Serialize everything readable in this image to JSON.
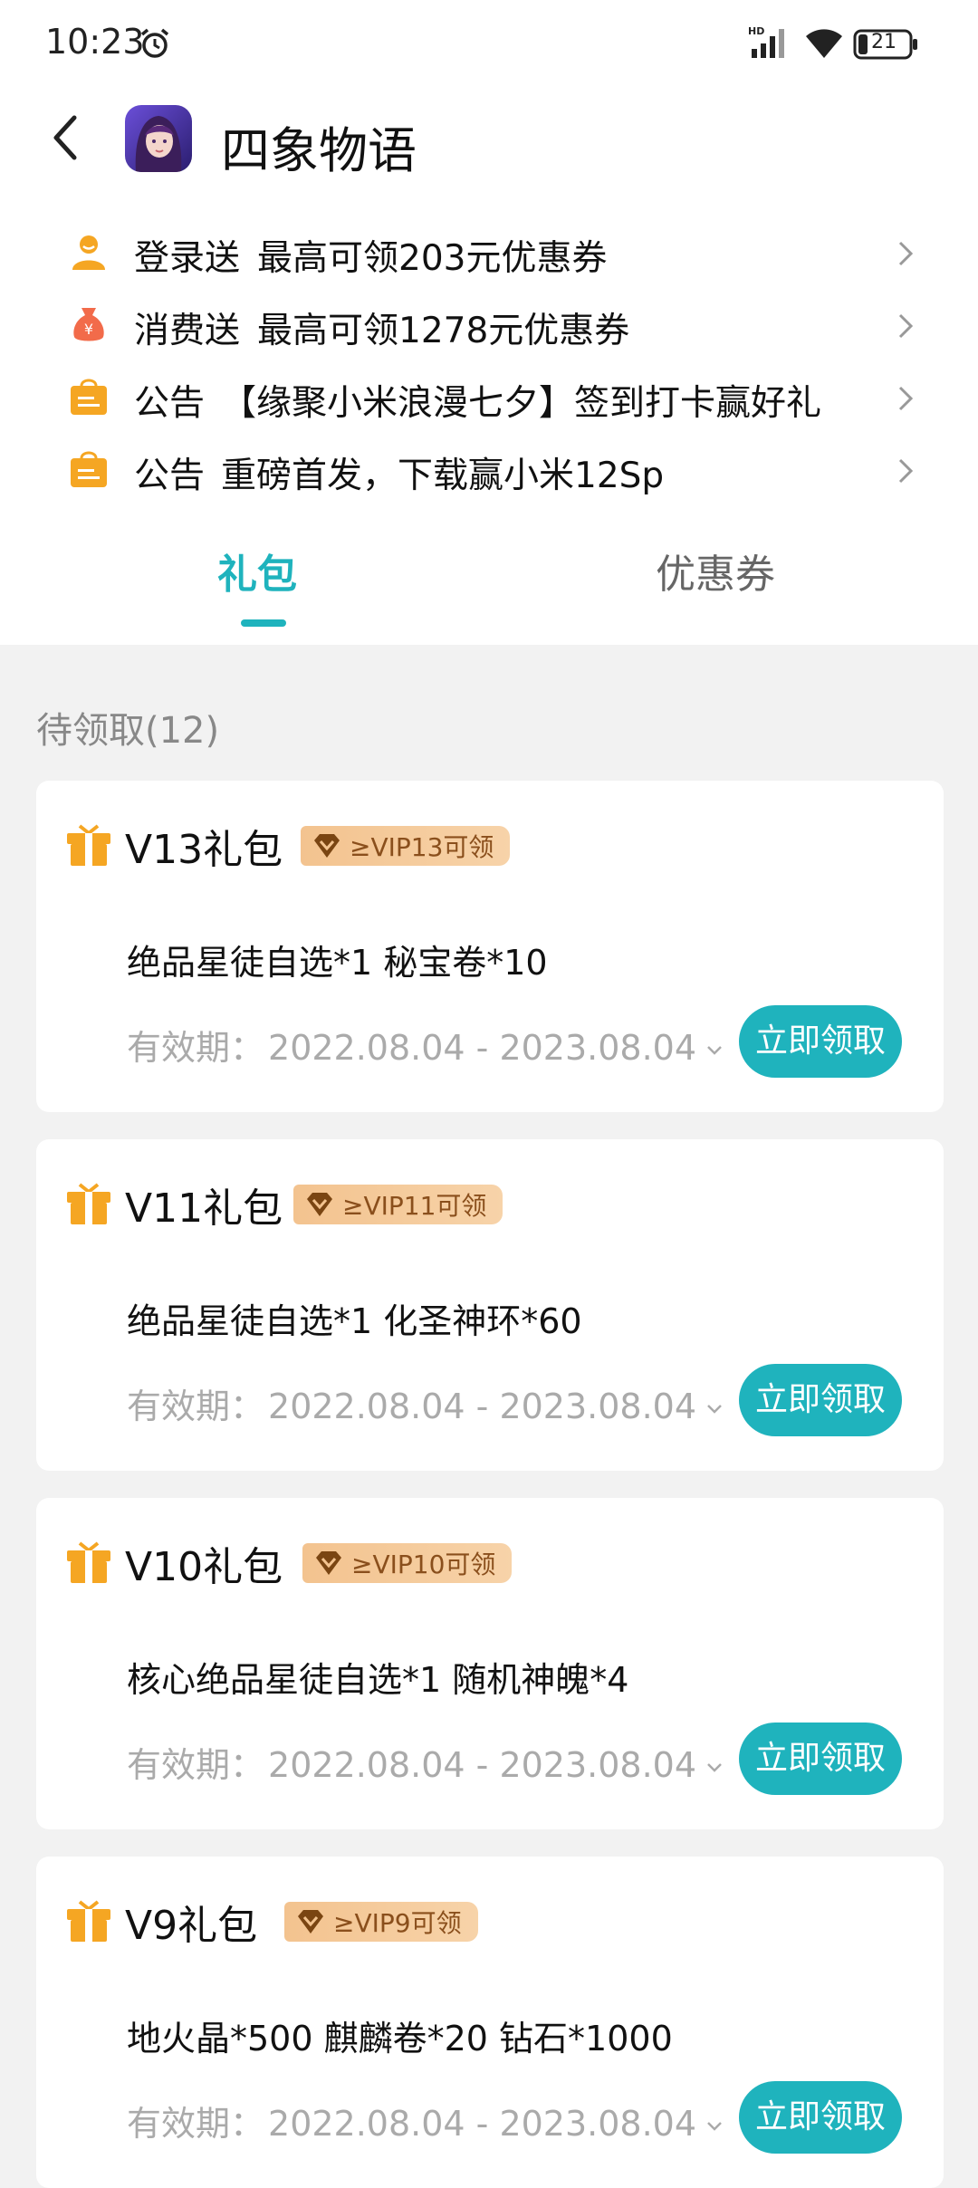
{
  "status_bar": {
    "time": "10:23",
    "battery": "21"
  },
  "header": {
    "title": "四象物语"
  },
  "notices": [
    {
      "label": "登录送",
      "text": "最高可领203元优惠券"
    },
    {
      "label": "消费送",
      "text": "最高可领1278元优惠券"
    },
    {
      "label": "公告",
      "text": "【缘聚小米浪漫七夕】签到打卡赢好礼"
    },
    {
      "label": "公告",
      "text": "重磅首发，下载赢小米12Sp"
    }
  ],
  "tabs": [
    {
      "label": "礼包"
    },
    {
      "label": "优惠券"
    }
  ],
  "section": {
    "title": "待领取(12)"
  },
  "gifts": [
    {
      "title": "V13礼包",
      "badge": "≥VIP13可领",
      "content": "绝品星徒自选*1 秘宝卷*10",
      "validity_label": "有效期：",
      "validity": "2022.08.04 - 2023.08.04",
      "button": "立即领取"
    },
    {
      "title": "V11礼包",
      "badge": "≥VIP11可领",
      "content": "绝品星徒自选*1 化圣神环*60",
      "validity_label": "有效期：",
      "validity": "2022.08.04 - 2023.08.04",
      "button": "立即领取"
    },
    {
      "title": "V10礼包",
      "badge": "≥VIP10可领",
      "content": "核心绝品星徒自选*1 随机神魄*4",
      "validity_label": "有效期：",
      "validity": "2022.08.04 - 2023.08.04",
      "button": "立即领取"
    },
    {
      "title": "V9礼包",
      "badge": "≥VIP9可领",
      "content": "地火晶*500 麒麟卷*20 钻石*1000",
      "validity_label": "有效期：",
      "validity": "2022.08.04 - 2023.08.04",
      "button": "立即领取"
    }
  ],
  "colors": {
    "accent": "#1fb3bd",
    "badge_bg": "#f3c38f",
    "notice_icon": "#f5a623"
  },
  "icons": {
    "notice_login": "user-icon",
    "notice_spend": "money-bag-icon",
    "notice_announce": "announcement-bag-icon",
    "gift": "gift-icon",
    "vip": "vip-diamond-icon"
  }
}
